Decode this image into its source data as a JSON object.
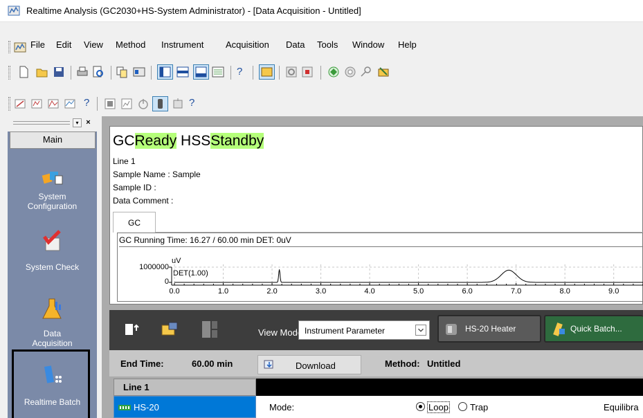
{
  "window": {
    "title": "Realtime Analysis (GC2030+HS-System Administrator) - [Data Acquisition - Untitled]"
  },
  "menu": {
    "items": [
      "File",
      "Edit",
      "View",
      "Method",
      "Instrument",
      "Acquisition",
      "Data",
      "Tools",
      "Window",
      "Help"
    ]
  },
  "sidebar": {
    "tab": "Main",
    "items": [
      {
        "label": "System\nConfiguration",
        "icon": "system-configuration-icon"
      },
      {
        "label": "System Check",
        "icon": "system-check-icon"
      },
      {
        "label": "Data\nAcquisition",
        "icon": "flask-icon"
      },
      {
        "label": "Realtime Batch",
        "icon": "realtime-batch-icon"
      }
    ]
  },
  "status": {
    "gc_prefix": "GC",
    "gc_state": "Ready",
    "hss_prefix": "HSS",
    "hss_state": "Standby",
    "line": "Line 1",
    "sample_name": "Sample Name : Sample",
    "sample_id": "Sample ID :",
    "data_comment": "Data Comment :",
    "tab": "GC"
  },
  "chart_data": {
    "type": "line",
    "title": "GC Running Time: 16.27 / 60.00 min DET: 0uV",
    "unit_label": "uV",
    "y_tick_top": "1000000",
    "y_tick_zero": "0",
    "legend": "DET(1.00)",
    "x_ticks": [
      "0.0",
      "1.0",
      "2.0",
      "3.0",
      "4.0",
      "5.0",
      "6.0",
      "7.0",
      "8.0",
      "9.0"
    ],
    "xlim": [
      0,
      9.6
    ],
    "peaks": [
      {
        "x": 2.15,
        "height": 0.85,
        "width": 0.02
      },
      {
        "x": 6.85,
        "height": 0.8,
        "width": 0.22
      }
    ]
  },
  "toolbar": {
    "view_mode_label": "View Mode:",
    "view_mode_value": "Instrument Parameter",
    "hs20_heater": "HS-20 Heater",
    "quick_batch": "Quick Batch..."
  },
  "info": {
    "end_time_label": "End Time:",
    "end_time_value": "60.00 min",
    "download": "Download",
    "method_label": "Method:",
    "method_value": "Untitled"
  },
  "table": {
    "line_header": "Line 1",
    "hs20": "HS-20",
    "mode_label": "Mode:",
    "mode_loop": "Loop",
    "mode_trap": "Trap",
    "equilibrate": "Equilibra"
  },
  "colors": {
    "status_highlight": "#b5ff7a",
    "sidebar_bg": "#7b8aa8",
    "selected_row": "#0078d7",
    "dark_toolbar": "#3d3d3d"
  }
}
